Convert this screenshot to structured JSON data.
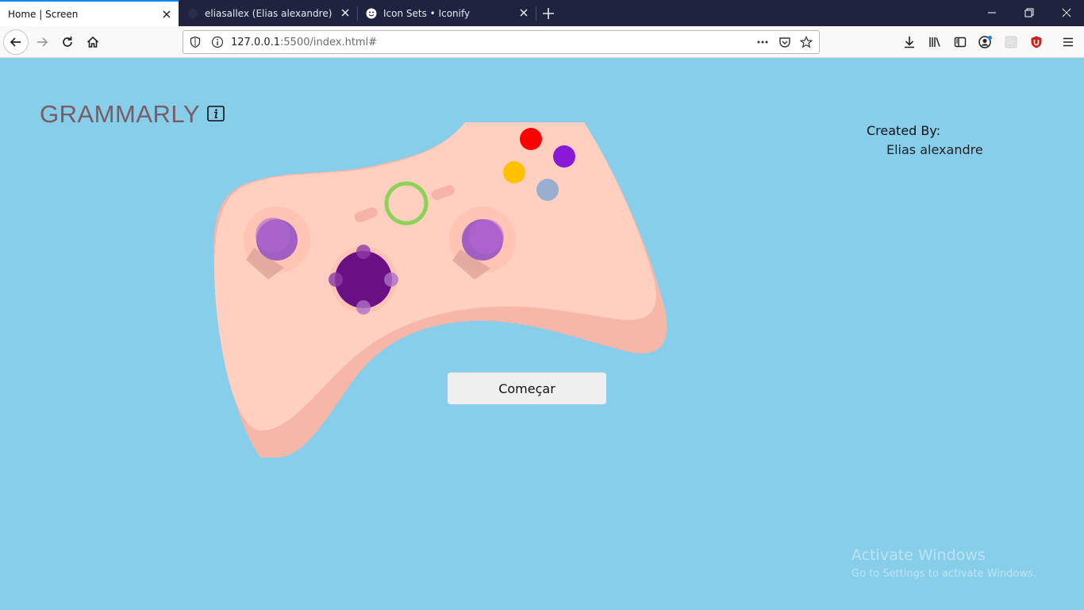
{
  "browser": {
    "tabs": [
      {
        "label": "Home | Screen",
        "active": true
      },
      {
        "label": "eliasallex (Elias alexandre)",
        "active": false
      },
      {
        "label": "Icon Sets • Iconify",
        "active": false
      }
    ],
    "url_host": "127.0.0.1",
    "url_rest": ":5500/index.html#",
    "icons": [
      "back-icon",
      "forward-icon",
      "reload-icon",
      "home-icon",
      "shield-icon",
      "info-icon",
      "more-icon",
      "pocket-icon",
      "bookmark-star-icon",
      "download-icon",
      "library-icon",
      "sidebar-icon",
      "account-icon",
      "extension-icon",
      "ublock-icon",
      "menu-icon"
    ]
  },
  "page": {
    "brand": "GRAMMARLY",
    "credit_label": "Created By:",
    "credit_name": "Elias alexandre",
    "start_button": "Começar"
  },
  "os_watermark": {
    "title": "Activate Windows",
    "subtitle": "Go to Settings to activate Windows."
  },
  "colors": {
    "background": "#87ceeb",
    "controller_body": "#ffd0c0",
    "controller_shadow": "#f6b6a8",
    "brand_text": "#7a5c63"
  }
}
